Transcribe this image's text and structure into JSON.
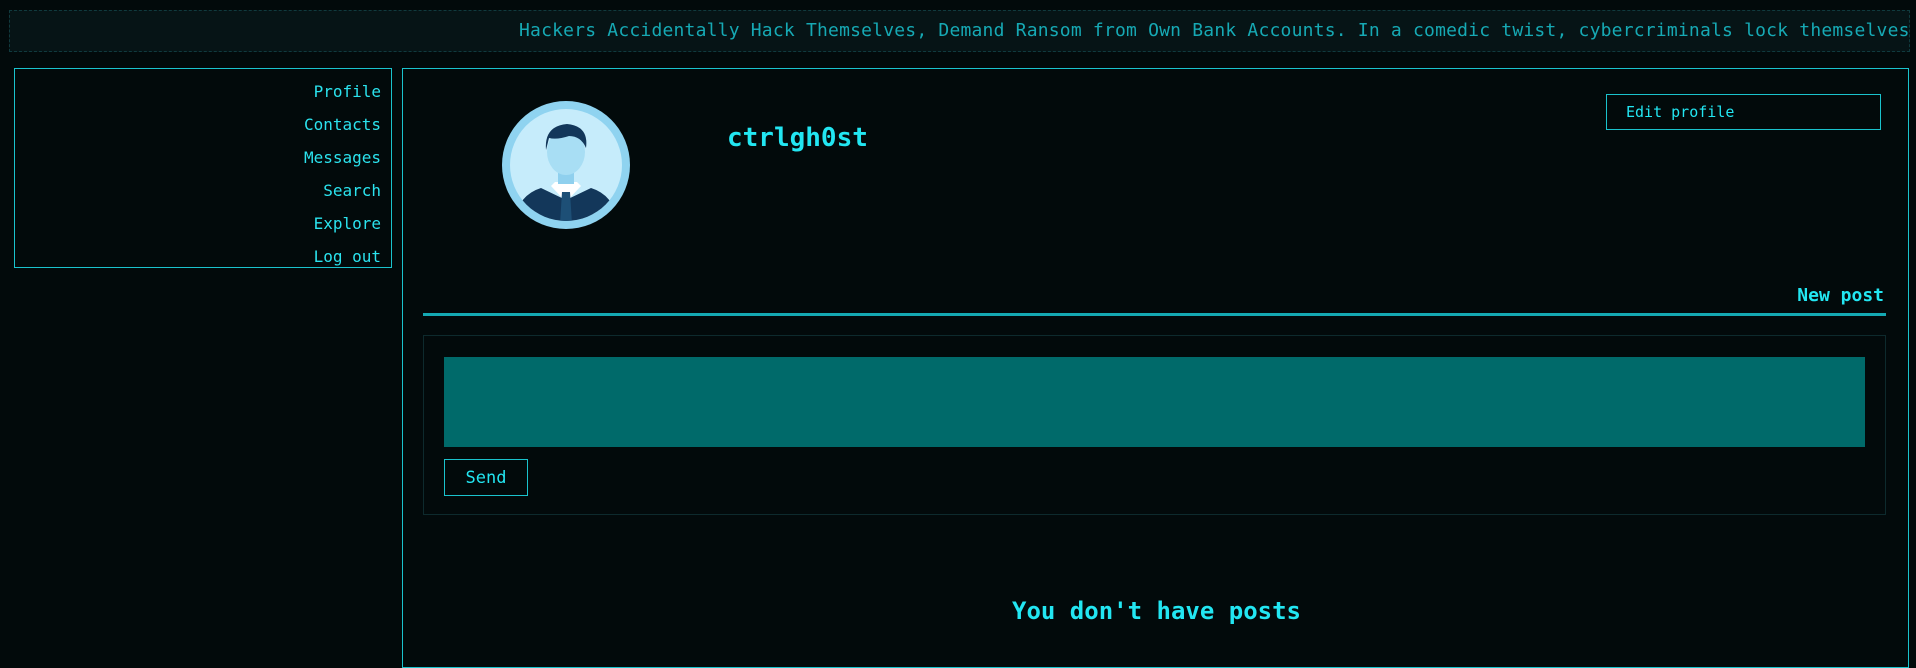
{
  "ticker": {
    "text": "Hackers Accidentally Hack Themselves, Demand Ransom from Own Bank Accounts. In a comedic twist, cybercriminals lock themselves out"
  },
  "sidebar": {
    "items": [
      {
        "label": "Profile"
      },
      {
        "label": "Contacts"
      },
      {
        "label": "Messages"
      },
      {
        "label": "Search"
      },
      {
        "label": "Explore"
      },
      {
        "label": "Log out"
      }
    ]
  },
  "profile": {
    "username": "ctrlgh0st",
    "edit_label": "Edit profile",
    "avatar_icon": "user-avatar-icon"
  },
  "new_post": {
    "label": "New post",
    "textarea_value": "",
    "send_label": "Send"
  },
  "posts": {
    "empty_text": "You don't have posts"
  },
  "colors": {
    "background": "#020a0b",
    "accent": "#1ac3cd",
    "textarea_bg": "#006a6a"
  }
}
